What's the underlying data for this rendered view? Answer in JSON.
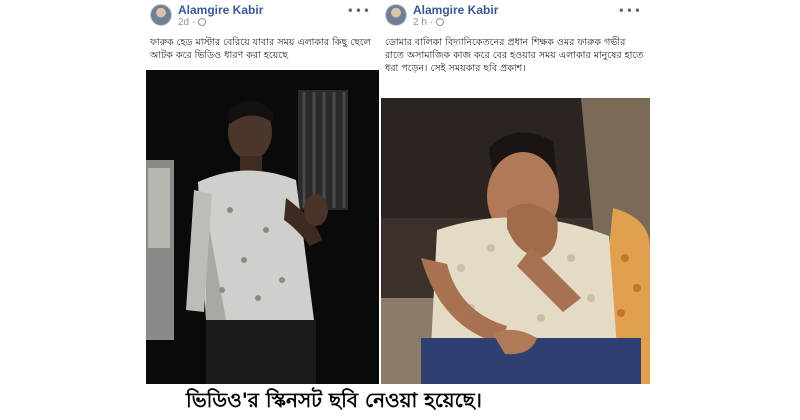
{
  "posts": [
    {
      "author": "Alamgire Kabir",
      "time": "2d",
      "text": "ফারুক হেড মাস্টার বেরিয়ে যাবার সময় এলাকার কিছু ছেলে আটক করে ভিডিও ধারণ করা হয়েছে",
      "more_icon": "more-options-icon",
      "privacy_icon": "globe-icon"
    },
    {
      "author": "Alamgire Kabir",
      "time": "2 h",
      "text": "ডোমার বালিকা বিদ্যানিকেতনের প্রধান শিক্ষক ওমর ফারুক গভীর রাতে অসামাজিক কাজ করে বের হওয়ার সময় এলাকার মানুষের হাতে ধরা পড়েন। সেই সময়কার ছবি প্রকাশ।",
      "more_icon": "more-options-icon",
      "privacy_icon": "globe-icon"
    }
  ],
  "caption": "ভিডিও'র স্কিনসট ছবি নেওয়া হয়েছে।"
}
